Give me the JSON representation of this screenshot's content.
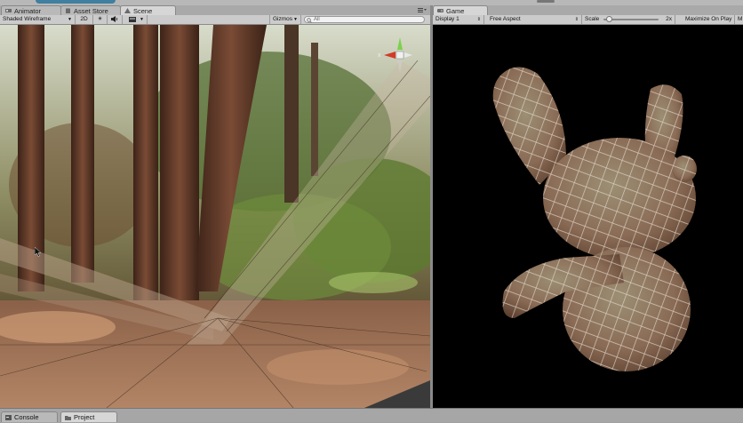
{
  "scene_panel": {
    "tabs": [
      {
        "label": "Animator",
        "icon": "animator-icon",
        "active": false
      },
      {
        "label": "Asset Store",
        "icon": "asset-store-icon",
        "active": false
      },
      {
        "label": "Scene",
        "icon": "scene-icon",
        "active": true
      }
    ],
    "toolbar": {
      "draw_mode": "Shaded Wireframe",
      "mode_2d": "2D",
      "lighting_icon": "sun-icon",
      "audio_icon": "speaker-icon",
      "effects_icon": "image-icon",
      "gizmos": "Gizmos",
      "search_placeholder": "All"
    },
    "gizmo_axes": {
      "x": "x"
    }
  },
  "game_panel": {
    "tab": {
      "label": "Game",
      "icon": "game-icon"
    },
    "toolbar": {
      "display": "Display 1",
      "aspect": "Free Aspect",
      "scale_label": "Scale",
      "scale_value": "2x",
      "scale_level": 0.05,
      "maximize": "Maximize On Play",
      "truncated": "M"
    }
  },
  "bottom": {
    "tabs": [
      {
        "label": "Console",
        "icon": "console-icon",
        "active": false
      },
      {
        "label": "Project",
        "icon": "project-icon",
        "active": true
      }
    ]
  },
  "colors": {
    "scene_bg": "#5c4a38",
    "game_bg": "#000000",
    "gizmo_x": "#d23a2a",
    "gizmo_y": "#7bd14f",
    "bunny": "#8a6b55"
  }
}
